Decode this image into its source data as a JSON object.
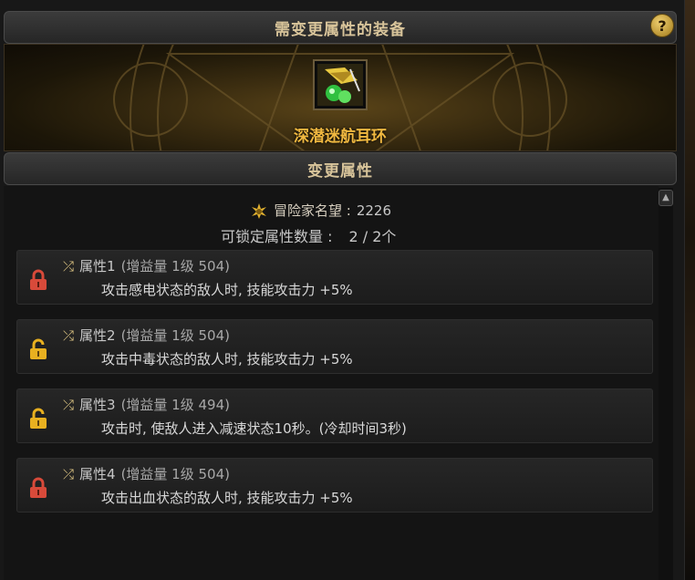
{
  "window": {
    "title": "需变更属性的装备",
    "help_label": "?"
  },
  "equipment": {
    "name": "深潜迷航耳环",
    "icon": "earring-item-icon"
  },
  "section": {
    "title": "变更属性"
  },
  "fame": {
    "label": "冒险家名望 :",
    "value": "2226",
    "icon": "fame-emblem-icon"
  },
  "lock_count": {
    "label": "可锁定属性数量 :",
    "value": "2 / 2个"
  },
  "attributes": [
    {
      "name": "属性1",
      "detail": "(增益量 1级 504)",
      "desc": "攻击感电状态的敌人时, 技能攻击力 +5%",
      "locked": true,
      "lock_color": "#d84a3a"
    },
    {
      "name": "属性2",
      "detail": "(增益量 1级 504)",
      "desc": "攻击中毒状态的敌人时, 技能攻击力 +5%",
      "locked": false,
      "lock_color": "#e8b020"
    },
    {
      "name": "属性3",
      "detail": "(增益量 1级 494)",
      "desc": "攻击时, 使敌人进入减速状态10秒。(冷却时间3秒)",
      "locked": false,
      "lock_color": "#e8b020"
    },
    {
      "name": "属性4",
      "detail": "(增益量 1级 504)",
      "desc": "攻击出血状态的敌人时, 技能攻击力 +5%",
      "locked": true,
      "lock_color": "#d84a3a"
    }
  ],
  "colors": {
    "title_text": "#d8c49a",
    "item_name": "#f0b840",
    "locked": "#d84a3a",
    "unlocked": "#e8b020"
  }
}
